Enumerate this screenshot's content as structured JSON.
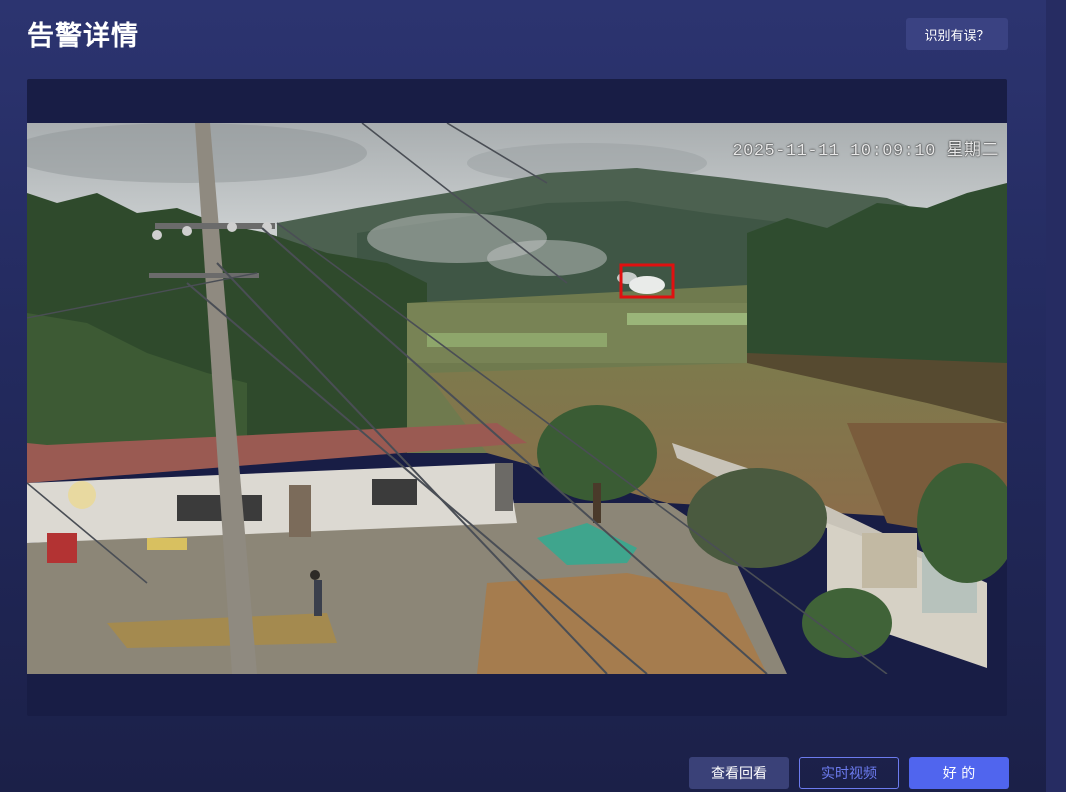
{
  "header": {
    "title": "告警详情",
    "report_label": "识别有误？"
  },
  "viewer": {
    "timestamp": "2025-11-11 10:09:10 星期二",
    "detection_color": "#e01010"
  },
  "footer": {
    "playback_label": "查看回看",
    "live_label": "实时视频",
    "ok_label": "好 的"
  },
  "colors": {
    "background": "#2a316b",
    "panel": "#181d45",
    "primary": "#5065ee",
    "outline_text": "#6c7bef",
    "secondary_button": "#3a4178"
  }
}
